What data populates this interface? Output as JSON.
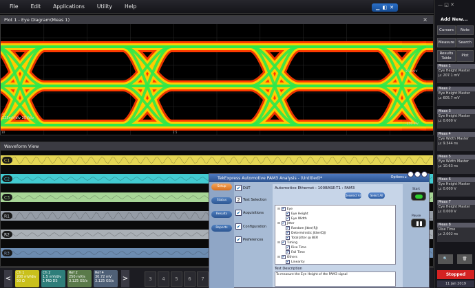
{
  "menu": [
    "File",
    "Edit",
    "Applications",
    "Utility",
    "Help"
  ],
  "plot": {
    "title": "Plot 1 - Eye Diagram(Meas 1)",
    "close": "×",
    "readouts": [
      "a",
      "125mV/div  2UI/div"
    ],
    "bottom_ticks": [
      "10",
      "2.5"
    ]
  },
  "waveform": {
    "title": "Waveform View",
    "channels": [
      "C1",
      "C2",
      "C3",
      "R1",
      "R2",
      "R3"
    ]
  },
  "bottom": {
    "channels": [
      {
        "name": "Ch 1",
        "l1": "200 mV/div",
        "l2": "50 Ω",
        "color": "#c9c01c"
      },
      {
        "name": "Ch 2",
        "l1": "1.5 mV/div",
        "l2": "1 MΩ  DS",
        "color": "#2e7e7a"
      },
      {
        "name": "Ref 2",
        "l1": "250 mV/s",
        "l2": "3.125 GS/s",
        "color": "#5a7a4a"
      },
      {
        "name": "Ref 4",
        "l1": "30.72 mV",
        "l2": "3.125 GS/s",
        "color": "#4f6077"
      }
    ],
    "nums": [
      "3",
      "4",
      "5",
      "6",
      "7"
    ],
    "prev": "<",
    "next": ">"
  },
  "right": {
    "add_new": "Add New...",
    "buttons": [
      "Cursors",
      "Note",
      "Measure",
      "Search",
      "Results Table",
      "Plot"
    ],
    "meas": [
      {
        "h": "Meas 1",
        "t1": "Eye Height Master",
        "t2": "μ: 207.1 mV"
      },
      {
        "h": "Meas 2",
        "t1": "Eye Height Master",
        "t2": "μ: 605.7 mV"
      },
      {
        "h": "Meas 3",
        "t1": "Eye Height Master",
        "t2": "μ: 0.000 V"
      },
      {
        "h": "Meas 4",
        "t1": "Eye Width Master",
        "t2": "μ: 9.344 ns"
      },
      {
        "h": "Meas 5",
        "t1": "Eye Width Master",
        "t2": "μ: 10.63 ns"
      },
      {
        "h": "Meas 6",
        "t1": "Eye Height Master",
        "t2": "μ: 0.000 V"
      },
      {
        "h": "Meas 7",
        "t1": "Eye Height Master",
        "t2": "μ: 0.000 V"
      },
      {
        "h": "Meas 8",
        "t1": "Rise Time",
        "t2": "μ: 2.002 ns"
      }
    ],
    "stopped": "Stopped",
    "date": "11 Jan 2019"
  },
  "dialog": {
    "title": "TekExpress Automotive PAM3 Analysis - (Untitled)*",
    "options": "Options ▸",
    "nav": [
      "Setup",
      "Status",
      "Results",
      "Reports"
    ],
    "steps": [
      "DUT",
      "Test Selection",
      "Acquisitions",
      "Configuration",
      "Preferences"
    ],
    "heading": "Automotive Ethernet : 100BASE-T1 : PAM3",
    "deselect": "Deselect All",
    "select": "Select All",
    "tree": [
      {
        "label": "Eye",
        "level": 0,
        "exp": "⊟"
      },
      {
        "label": "Eye Height",
        "level": 1
      },
      {
        "label": "Eye Width",
        "level": 1
      },
      {
        "label": "Jitter",
        "level": 0,
        "exp": "⊟"
      },
      {
        "label": "Random Jitter(RJ)",
        "level": 1
      },
      {
        "label": "Deterministic Jitter(DJ)",
        "level": 1
      },
      {
        "label": "Total Jitter @ BER",
        "level": 1
      },
      {
        "label": "Timing",
        "level": 0,
        "exp": "⊟"
      },
      {
        "label": "Rise Time",
        "level": 1
      },
      {
        "label": "Fall Time",
        "level": 1
      },
      {
        "label": "Others",
        "level": 0,
        "exp": "⊟"
      },
      {
        "label": "Linearity",
        "level": 1
      }
    ],
    "desc_label": "Test Description",
    "desc": "To measure the Eye Height of the PAM3 signal",
    "start": "Start",
    "pause": "Pause"
  },
  "colors": {
    "eye_outer": "#ff3b00",
    "eye_mid": "#ffd000",
    "eye_inner": "#2ee84a",
    "accent": "#2c538f"
  }
}
